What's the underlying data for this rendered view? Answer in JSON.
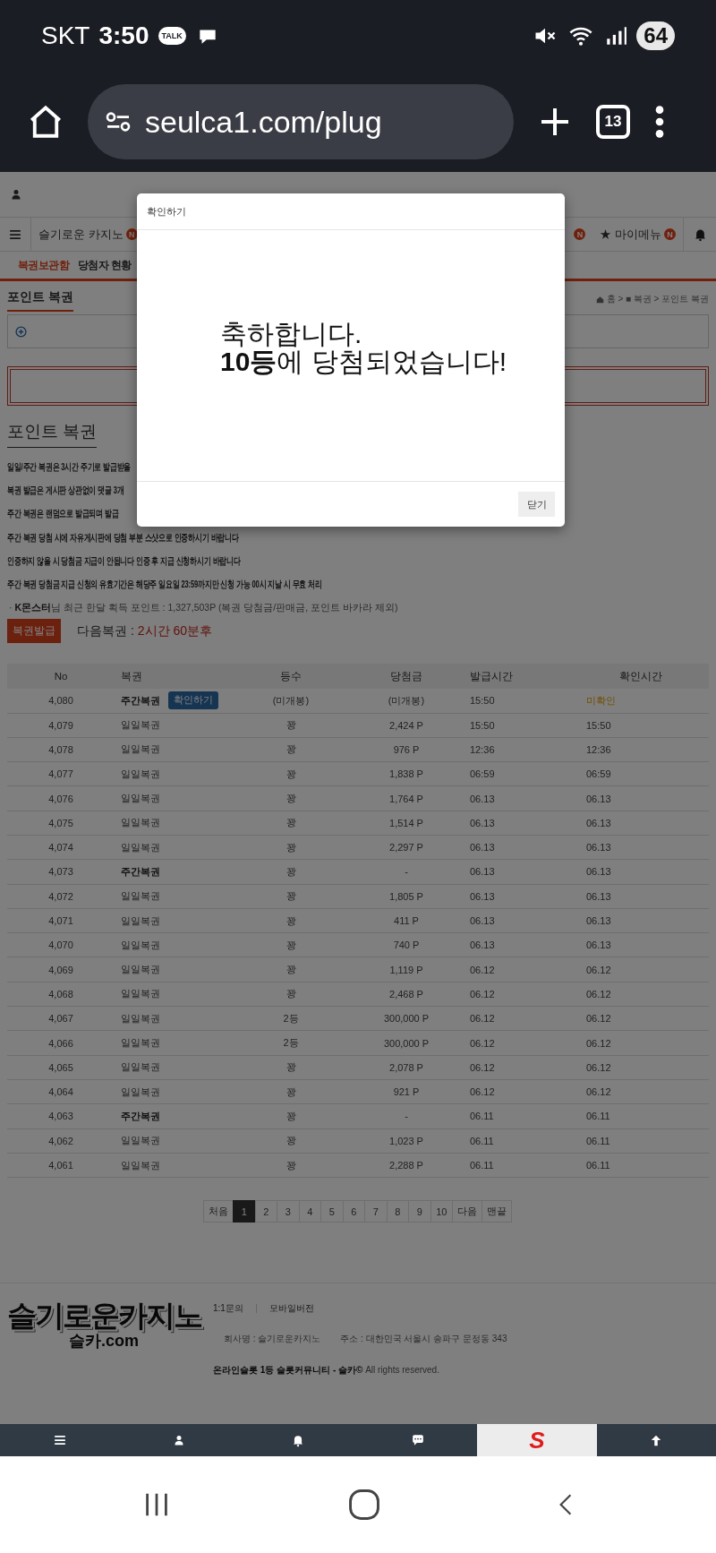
{
  "status_bar": {
    "carrier": "SKT",
    "time": "3:50",
    "talk_badge": "TALK",
    "battery": "64"
  },
  "browser": {
    "url": "seulca1.com/plug",
    "tab_count": "13"
  },
  "nav": {
    "left": [
      {
        "label": "슬기로운 카지노",
        "badge": "N"
      }
    ],
    "right": [
      {
        "badge": "N"
      },
      {
        "label": "★ 마이메뉴",
        "badge": "N"
      }
    ]
  },
  "subtabs": [
    {
      "label": "복권보관함",
      "selected": true
    },
    {
      "label": "당첨자 현황",
      "selected": false
    }
  ],
  "section": {
    "title": "포인트 복권",
    "breadcrumb": "홈 > ■ 복권 > 포인트 복권"
  },
  "heading": "포인트 복권",
  "rules": [
    "일일/주간 복권은 3시간 주기로 발급받을",
    "복권 발급은 게시판 상관없이 댓글 3개",
    "주간 복권은 랜덤으로 발급되며 발급",
    "주간 복권 당첨 시에 자유게시판에 당첨 부분 스샷으로 인증하시기 바랍니다",
    "인증하지 않을 시 당첨금 지급이 안됩니다 인증 후 지급 신청하시기 바랍니다",
    "주간 복권 당첨금 지급 신청의 유효기간은 해당주 일요일 23:59까지만 신청 가능 00시 지날 시 무효 처리"
  ],
  "summary": "· **K몬스터**님 최근 한달 획득 포인트 : 1,327,503P (복권 당첨금/판매금, 포인트 바카라 제외)",
  "issue_button": "복권발급",
  "next": {
    "label": "다음복권 :",
    "value": "2시간 60분후"
  },
  "table": {
    "columns": [
      "No",
      "복권",
      "등수",
      "당첨금",
      "발급시간",
      "확인시간"
    ],
    "rows": [
      {
        "no": "4,080",
        "ticket": "주간복권",
        "kind": "weekly",
        "action": "확인하기",
        "rank": "(미개봉)",
        "prize": "(미개봉)",
        "issued": "15:50",
        "checked": "미확인",
        "confirmed": false
      },
      {
        "no": "4,079",
        "ticket": "일일복권",
        "kind": "daily",
        "rank": "꽝",
        "prize": "2,424 P",
        "issued": "15:50",
        "checked": "15:50",
        "confirmed": true
      },
      {
        "no": "4,078",
        "ticket": "일일복권",
        "kind": "daily",
        "rank": "꽝",
        "prize": "976 P",
        "issued": "12:36",
        "checked": "12:36",
        "confirmed": true
      },
      {
        "no": "4,077",
        "ticket": "일일복권",
        "kind": "daily",
        "rank": "꽝",
        "prize": "1,838 P",
        "issued": "06:59",
        "checked": "06:59",
        "confirmed": true
      },
      {
        "no": "4,076",
        "ticket": "일일복권",
        "kind": "daily",
        "rank": "꽝",
        "prize": "1,764 P",
        "issued": "06.13",
        "checked": "06.13",
        "confirmed": true
      },
      {
        "no": "4,075",
        "ticket": "일일복권",
        "kind": "daily",
        "rank": "꽝",
        "prize": "1,514 P",
        "issued": "06.13",
        "checked": "06.13",
        "confirmed": true
      },
      {
        "no": "4,074",
        "ticket": "일일복권",
        "kind": "daily",
        "rank": "꽝",
        "prize": "2,297 P",
        "issued": "06.13",
        "checked": "06.13",
        "confirmed": true
      },
      {
        "no": "4,073",
        "ticket": "주간복권",
        "kind": "weekly",
        "rank": "꽝",
        "prize": "-",
        "issued": "06.13",
        "checked": "06.13",
        "confirmed": true
      },
      {
        "no": "4,072",
        "ticket": "일일복권",
        "kind": "daily",
        "rank": "꽝",
        "prize": "1,805 P",
        "issued": "06.13",
        "checked": "06.13",
        "confirmed": true
      },
      {
        "no": "4,071",
        "ticket": "일일복권",
        "kind": "daily",
        "rank": "꽝",
        "prize": "411 P",
        "issued": "06.13",
        "checked": "06.13",
        "confirmed": true
      },
      {
        "no": "4,070",
        "ticket": "일일복권",
        "kind": "daily",
        "rank": "꽝",
        "prize": "740 P",
        "issued": "06.13",
        "checked": "06.13",
        "confirmed": true
      },
      {
        "no": "4,069",
        "ticket": "일일복권",
        "kind": "daily",
        "rank": "꽝",
        "prize": "1,119 P",
        "issued": "06.12",
        "checked": "06.12",
        "confirmed": true
      },
      {
        "no": "4,068",
        "ticket": "일일복권",
        "kind": "daily",
        "rank": "꽝",
        "prize": "2,468 P",
        "issued": "06.12",
        "checked": "06.12",
        "confirmed": true
      },
      {
        "no": "4,067",
        "ticket": "일일복권",
        "kind": "daily",
        "rank": "2등",
        "prize": "300,000 P",
        "issued": "06.12",
        "checked": "06.12",
        "confirmed": true
      },
      {
        "no": "4,066",
        "ticket": "일일복권",
        "kind": "daily",
        "rank": "2등",
        "prize": "300,000 P",
        "issued": "06.12",
        "checked": "06.12",
        "confirmed": true
      },
      {
        "no": "4,065",
        "ticket": "일일복권",
        "kind": "daily",
        "rank": "꽝",
        "prize": "2,078 P",
        "issued": "06.12",
        "checked": "06.12",
        "confirmed": true
      },
      {
        "no": "4,064",
        "ticket": "일일복권",
        "kind": "daily",
        "rank": "꽝",
        "prize": "921 P",
        "issued": "06.12",
        "checked": "06.12",
        "confirmed": true
      },
      {
        "no": "4,063",
        "ticket": "주간복권",
        "kind": "weekly",
        "rank": "꽝",
        "prize": "-",
        "issued": "06.11",
        "checked": "06.11",
        "confirmed": true
      },
      {
        "no": "4,062",
        "ticket": "일일복권",
        "kind": "daily",
        "rank": "꽝",
        "prize": "1,023 P",
        "issued": "06.11",
        "checked": "06.11",
        "confirmed": true
      },
      {
        "no": "4,061",
        "ticket": "일일복권",
        "kind": "daily",
        "rank": "꽝",
        "prize": "2,288 P",
        "issued": "06.11",
        "checked": "06.11",
        "confirmed": true
      }
    ]
  },
  "pagination": {
    "first": "처음",
    "pages": [
      {
        "label": "1",
        "selected": true
      },
      {
        "label": "2",
        "selected": false
      },
      {
        "label": "3",
        "selected": false
      },
      {
        "label": "4",
        "selected": false
      },
      {
        "label": "5",
        "selected": false
      },
      {
        "label": "6",
        "selected": false
      },
      {
        "label": "7",
        "selected": false
      },
      {
        "label": "8",
        "selected": false
      },
      {
        "label": "9",
        "selected": false
      },
      {
        "label": "10",
        "selected": false
      }
    ],
    "next": "다음",
    "last": "맨끝"
  },
  "footer": {
    "logo": "슬기로운카지노",
    "logo_sub": "슬카.com",
    "links": [
      "1:1문의",
      "모바일버전"
    ],
    "company": "회사명 : 슬기로운카지노",
    "address": "주소 : 대한민국 서울시 송파구 문정동 343",
    "copyright": "**온라인슬롯 1등 슬롯커뮤니티 - 슬카©** All rights reserved."
  },
  "bottom_nav": {
    "logo": "S"
  },
  "modal": {
    "title": "확인하기",
    "lines": [
      "축하합니다.",
      "**10등**에 당첨되었습니다!"
    ],
    "close": "닫기"
  }
}
